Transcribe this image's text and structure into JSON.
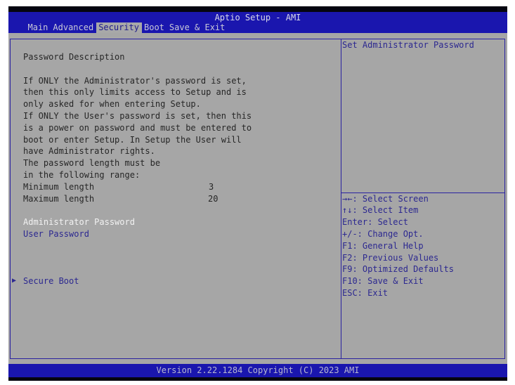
{
  "header": {
    "title": "Aptio Setup - AMI",
    "tabs": [
      "Main",
      "Advanced",
      "Security",
      "Boot",
      "Save & Exit"
    ],
    "active_tab": "Security"
  },
  "left": {
    "heading": "Password Description",
    "description": [
      "If ONLY the Administrator's password is set,",
      "then this only limits access to Setup and is",
      "only asked for when entering Setup.",
      "If ONLY the User's password is set, then this",
      "is a power on password and must be entered to",
      "boot or enter Setup. In Setup the User will",
      "have Administrator rights.",
      "The password length must be",
      "in the following range:"
    ],
    "min_label": "Minimum length",
    "min_value": "3",
    "max_label": "Maximum length",
    "max_value": "20",
    "admin_password": "Administrator Password",
    "user_password": "User Password",
    "secure_boot": "Secure Boot"
  },
  "right": {
    "help_text": "Set Administrator Password",
    "keys": [
      "→←: Select Screen",
      "↑↓: Select Item",
      "Enter: Select",
      "+/-: Change Opt.",
      "F1: General Help",
      "F2: Previous Values",
      "F9: Optimized Defaults",
      "F10: Save & Exit",
      "ESC: Exit"
    ]
  },
  "footer": {
    "text": "Version 2.22.1284 Copyright (C) 2023 AMI"
  }
}
